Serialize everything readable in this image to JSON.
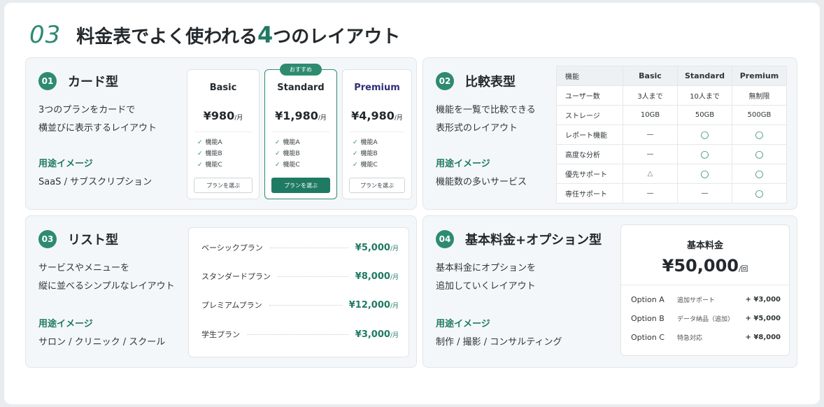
{
  "header": {
    "number": "03",
    "title_before": "料金表でよく使われる",
    "title_number": "4",
    "title_after": "つのレイアウト"
  },
  "card_layout": {
    "num": "01",
    "title": "カード型",
    "desc": [
      "3つのプランをカードで",
      "横並びに表示するレイアウト"
    ],
    "usage_label": "用途イメージ",
    "usage": "SaaS / サブスクリプション",
    "recommend_tag": "おすすめ",
    "cards": [
      {
        "name": "Basic",
        "price": "¥980",
        "unit": "/月",
        "features": [
          "機能A",
          "機能B",
          "機能C"
        ],
        "button": "プランを選ぶ"
      },
      {
        "name": "Standard",
        "price": "¥1,980",
        "unit": "/月",
        "features": [
          "機能A",
          "機能B",
          "機能C"
        ],
        "button": "プランを選ぶ"
      },
      {
        "name": "Premium",
        "price": "¥4,980",
        "unit": "/月",
        "features": [
          "機能A",
          "機能B",
          "機能C"
        ],
        "button": "プランを選ぶ"
      }
    ],
    "check": "✓"
  },
  "comparison_layout": {
    "num": "02",
    "title": "比較表型",
    "desc": [
      "機能を一覧で比較できる",
      "表形式のレイアウト"
    ],
    "usage_label": "用途イメージ",
    "usage": "機能数の多いサービス",
    "headers": [
      "機能",
      "Basic",
      "Standard",
      "Premium"
    ],
    "rows": [
      [
        "ユーザー数",
        "3人まで",
        "10人まで",
        "無制限"
      ],
      [
        "ストレージ",
        "10GB",
        "50GB",
        "500GB"
      ],
      [
        "レポート機能",
        "—",
        "○",
        "○"
      ],
      [
        "高度な分析",
        "—",
        "○",
        "○"
      ],
      [
        "優先サポート",
        "△",
        "○",
        "○"
      ],
      [
        "専任サポート",
        "—",
        "—",
        "○"
      ]
    ]
  },
  "list_layout": {
    "num": "03",
    "title": "リスト型",
    "desc": [
      "サービスやメニューを",
      "縦に並べるシンプルなレイアウト"
    ],
    "usage_label": "用途イメージ",
    "usage": "サロン / クリニック / スクール",
    "items": [
      {
        "name": "ベーシックプラン",
        "price": "¥5,000",
        "unit": "/月"
      },
      {
        "name": "スタンダードプラン",
        "price": "¥8,000",
        "unit": "/月"
      },
      {
        "name": "プレミアムプラン",
        "price": "¥12,000",
        "unit": "/月"
      },
      {
        "name": "学生プラン",
        "price": "¥3,000",
        "unit": "/月"
      }
    ]
  },
  "option_layout": {
    "num": "04",
    "title": "基本料金+オプション型",
    "desc": [
      "基本料金にオプションを",
      "追加していくレイアウト"
    ],
    "usage_label": "用途イメージ",
    "usage": "制作 / 撮影 / コンサルティング",
    "base_label": "基本料金",
    "base_price": "¥50,000",
    "base_unit": "/回",
    "options": [
      {
        "name": "Option A",
        "desc": "追加サポート",
        "price": "+ ¥3,000"
      },
      {
        "name": "Option B",
        "desc": "データ納品（追加）",
        "price": "+ ¥5,000"
      },
      {
        "name": "Option C",
        "desc": "特急対応",
        "price": "+ ¥8,000"
      }
    ]
  },
  "colors": {
    "accent": "#1f7a63",
    "panel_bg": "#f4f7f9"
  }
}
